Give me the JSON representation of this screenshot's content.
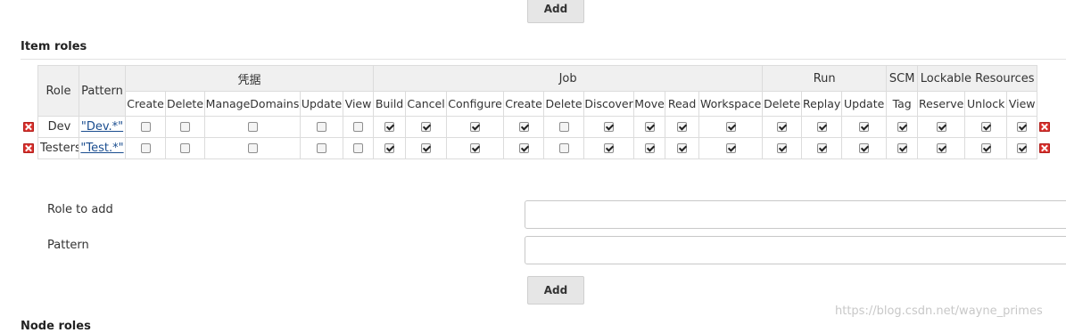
{
  "buttons": {
    "add_top": "Add",
    "add_bottom": "Add"
  },
  "sections": {
    "item_roles": "Item roles",
    "node_roles": "Node roles"
  },
  "table": {
    "col_role": "Role",
    "col_pattern": "Pattern",
    "groups": [
      {
        "label": "凭据",
        "perms": [
          "Create",
          "Delete",
          "ManageDomains",
          "Update",
          "View"
        ]
      },
      {
        "label": "Job",
        "perms": [
          "Build",
          "Cancel",
          "Configure",
          "Create",
          "Delete",
          "Discover",
          "Move",
          "Read",
          "Workspace"
        ]
      },
      {
        "label": "Run",
        "perms": [
          "Delete",
          "Replay",
          "Update"
        ]
      },
      {
        "label": "SCM",
        "perms": [
          "Tag"
        ]
      },
      {
        "label": "Lockable Resources",
        "perms": [
          "Reserve",
          "Unlock",
          "View"
        ]
      }
    ],
    "rows": [
      {
        "role": "Dev",
        "pattern": "\"Dev.*\"",
        "checked": [
          false,
          false,
          false,
          false,
          false,
          true,
          true,
          true,
          true,
          false,
          true,
          true,
          true,
          true,
          true,
          true,
          true,
          true,
          true,
          true,
          true
        ]
      },
      {
        "role": "Testers",
        "pattern": "\"Test.*\"",
        "checked": [
          false,
          false,
          false,
          false,
          false,
          true,
          true,
          true,
          true,
          false,
          true,
          true,
          true,
          true,
          true,
          true,
          true,
          true,
          true,
          true,
          true
        ]
      }
    ]
  },
  "form": {
    "role_to_add_label": "Role to add",
    "pattern_label": "Pattern",
    "role_to_add_value": "",
    "pattern_value": ""
  },
  "watermark": "https://blog.csdn.net/wayne_primes",
  "colors": {
    "delete_icon": "#d9302c",
    "link": "#1a4d8f",
    "header_bg": "#f0f0f0"
  }
}
